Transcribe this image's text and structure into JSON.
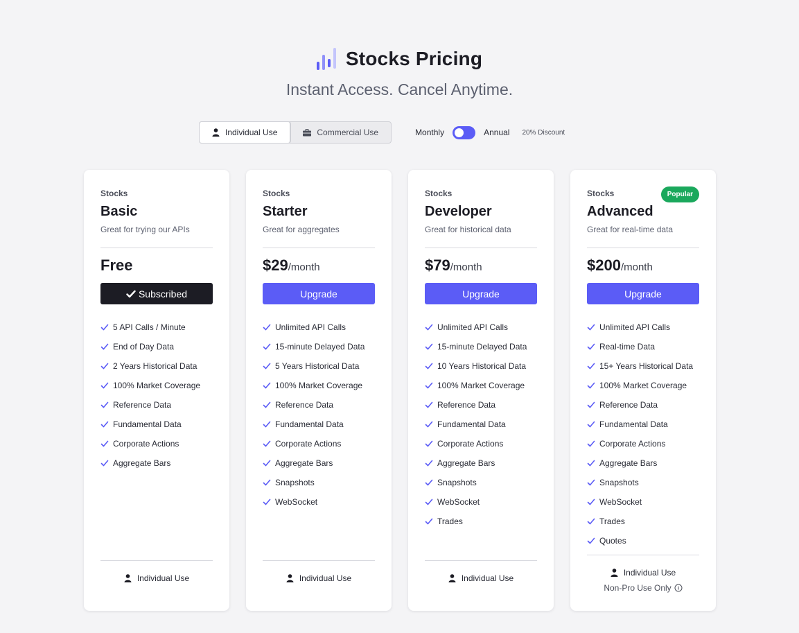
{
  "header": {
    "title": "Stocks Pricing",
    "subtitle": "Instant Access. Cancel Anytime.",
    "logo_icon": "bar-chart-logo-icon",
    "logo_colors": [
      "#5b5cf6",
      "#8f90f9",
      "#c4c5fc"
    ]
  },
  "usage_toggle": {
    "individual": "Individual Use",
    "commercial": "Commercial Use",
    "selected": "Individual Use"
  },
  "billing": {
    "monthly": "Monthly",
    "annual": "Annual",
    "discount": "20% Discount",
    "selected": "Monthly"
  },
  "colors": {
    "accent": "#5b5cf6",
    "dark": "#1c1c24",
    "popular": "#1aa85c"
  },
  "plans": [
    {
      "category": "Stocks",
      "name": "Basic",
      "description": "Great for trying our APIs",
      "price": "Free",
      "per": "",
      "cta": "Subscribed",
      "features": [
        "5 API Calls / Minute",
        "End of Day Data",
        "2 Years Historical Data",
        "100% Market Coverage",
        "Reference Data",
        "Fundamental Data",
        "Corporate Actions",
        "Aggregate Bars"
      ],
      "footer": "Individual Use"
    },
    {
      "category": "Stocks",
      "name": "Starter",
      "description": "Great for aggregates",
      "price": "$29",
      "per": "/month",
      "cta": "Upgrade",
      "features": [
        "Unlimited API Calls",
        "15-minute Delayed Data",
        "5 Years Historical Data",
        "100% Market Coverage",
        "Reference Data",
        "Fundamental Data",
        "Corporate Actions",
        "Aggregate Bars",
        "Snapshots",
        "WebSocket"
      ],
      "footer": "Individual Use"
    },
    {
      "category": "Stocks",
      "name": "Developer",
      "description": "Great for historical data",
      "price": "$79",
      "per": "/month",
      "cta": "Upgrade",
      "features": [
        "Unlimited API Calls",
        "15-minute Delayed Data",
        "10 Years Historical Data",
        "100% Market Coverage",
        "Reference Data",
        "Fundamental Data",
        "Corporate Actions",
        "Aggregate Bars",
        "Snapshots",
        "WebSocket",
        "Trades"
      ],
      "footer": "Individual Use"
    },
    {
      "category": "Stocks",
      "name": "Advanced",
      "description": "Great for real-time data",
      "price": "$200",
      "per": "/month",
      "cta": "Upgrade",
      "badge": "Popular",
      "features": [
        "Unlimited API Calls",
        "Real-time Data",
        "15+ Years Historical Data",
        "100% Market Coverage",
        "Reference Data",
        "Fundamental Data",
        "Corporate Actions",
        "Aggregate Bars",
        "Snapshots",
        "WebSocket",
        "Trades",
        "Quotes"
      ],
      "footer": "Individual Use",
      "footer_note": "Non-Pro Use Only"
    }
  ]
}
